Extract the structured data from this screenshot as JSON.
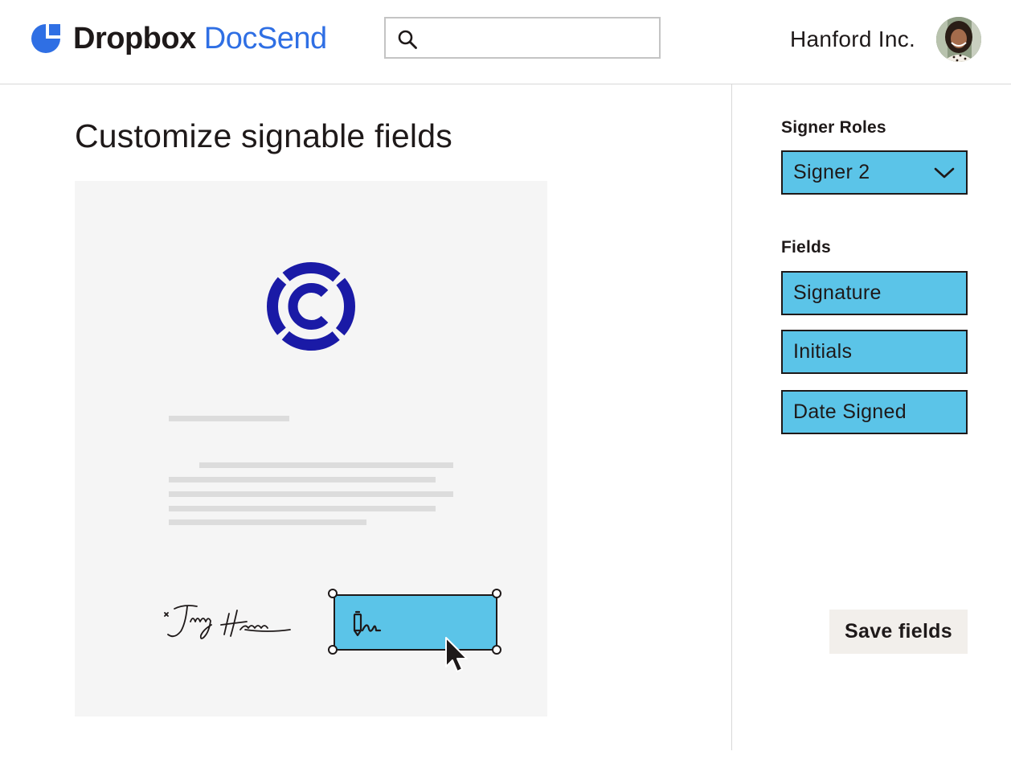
{
  "header": {
    "brand_main": "Dropbox",
    "brand_sub": "DocSend",
    "search_placeholder": "",
    "account_name": "Hanford Inc.",
    "icons": [
      "dropbox-docsend-logo-icon",
      "search-icon",
      "avatar"
    ]
  },
  "main": {
    "title": "Customize signable fields",
    "document": {
      "icons": [
        "company-logo-icon",
        "signature-image",
        "signature-pen-icon",
        "mouse-cursor-icon"
      ]
    }
  },
  "panel": {
    "signer_roles_label": "Signer Roles",
    "signer_selected": "Signer 2",
    "fields_label": "Fields",
    "fields": [
      "Signature",
      "Initials",
      "Date Signed"
    ],
    "save_label": "Save fields"
  },
  "colors": {
    "accent_blue": "#5bc4e8",
    "brand_blue": "#2f6fe4",
    "logo_navy": "#1a1aa6",
    "text": "#1e1919",
    "save_button_bg": "#f2efeb"
  }
}
